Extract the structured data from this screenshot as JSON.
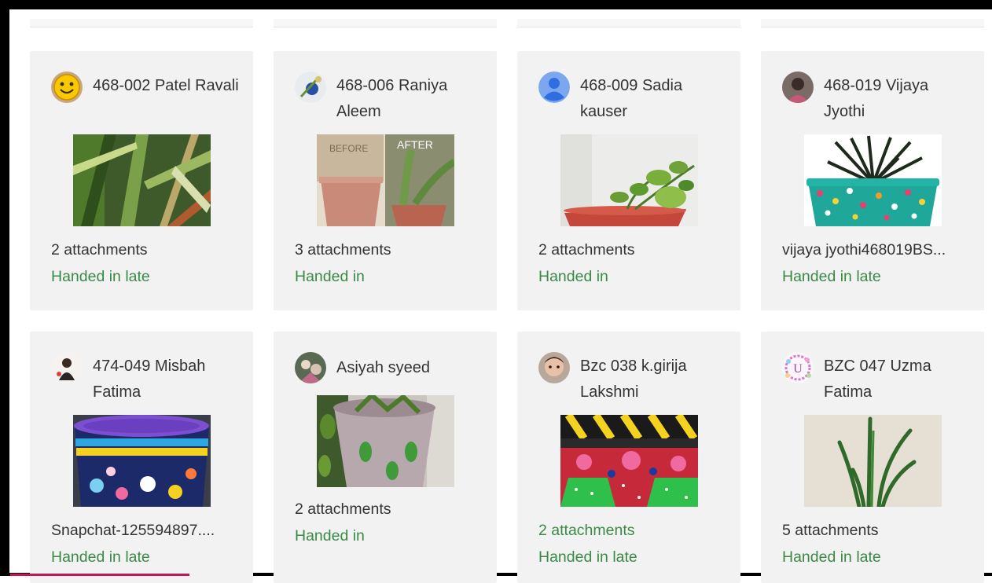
{
  "students": [
    {
      "name": "468-002 Patel Ravali",
      "attachments": "2 attachments",
      "status": "Handed in late",
      "avatar": "smiley-avatar",
      "thumb": "palm-leaves"
    },
    {
      "name": "468-006 Raniya Aleem",
      "attachments": "3 attachments",
      "status": "Handed in",
      "avatar": "photo-avatar",
      "thumb": "before-after-pots",
      "before_label": "BEFORE",
      "after_label": "AFTER"
    },
    {
      "name": "468-009 Sadia kauser",
      "attachments": "2 attachments",
      "status": "Handed in",
      "avatar": "default-person-avatar",
      "thumb": "money-plant-pot"
    },
    {
      "name": "468-019 Vijaya Jyothi",
      "attachments": "vijaya jyothi468019BS...",
      "status": "Handed in late",
      "avatar": "photo-avatar",
      "thumb": "teal-dotted-pot"
    },
    {
      "name": "474-049 Misbah Fatima",
      "attachments": "Snapchat-125594897....",
      "status": "Handed in late",
      "avatar": "photo-avatar",
      "thumb": "purple-painted-pot"
    },
    {
      "name": "Asiyah syeed",
      "attachments": "2 attachments",
      "status": "Handed in",
      "avatar": "photo-avatar",
      "thumb": "green-spotted-pot"
    },
    {
      "name": "Bzc 038 k.girija Lakshmi",
      "attachments": "2 attachments",
      "status": "Handed in late",
      "avatar": "photo-avatar",
      "thumb": "colorful-painted-pot"
    },
    {
      "name": "BZC 047 Uzma Fatima",
      "attachments": "5 attachments",
      "status": "Handed in late",
      "avatar": "letter-avatar",
      "avatar_letter": "U",
      "thumb": "snake-plant"
    }
  ],
  "colors": {
    "status_green": "#3a8a45",
    "card_bg": "#f2f2f2",
    "accent_bar": "#c2185b"
  }
}
